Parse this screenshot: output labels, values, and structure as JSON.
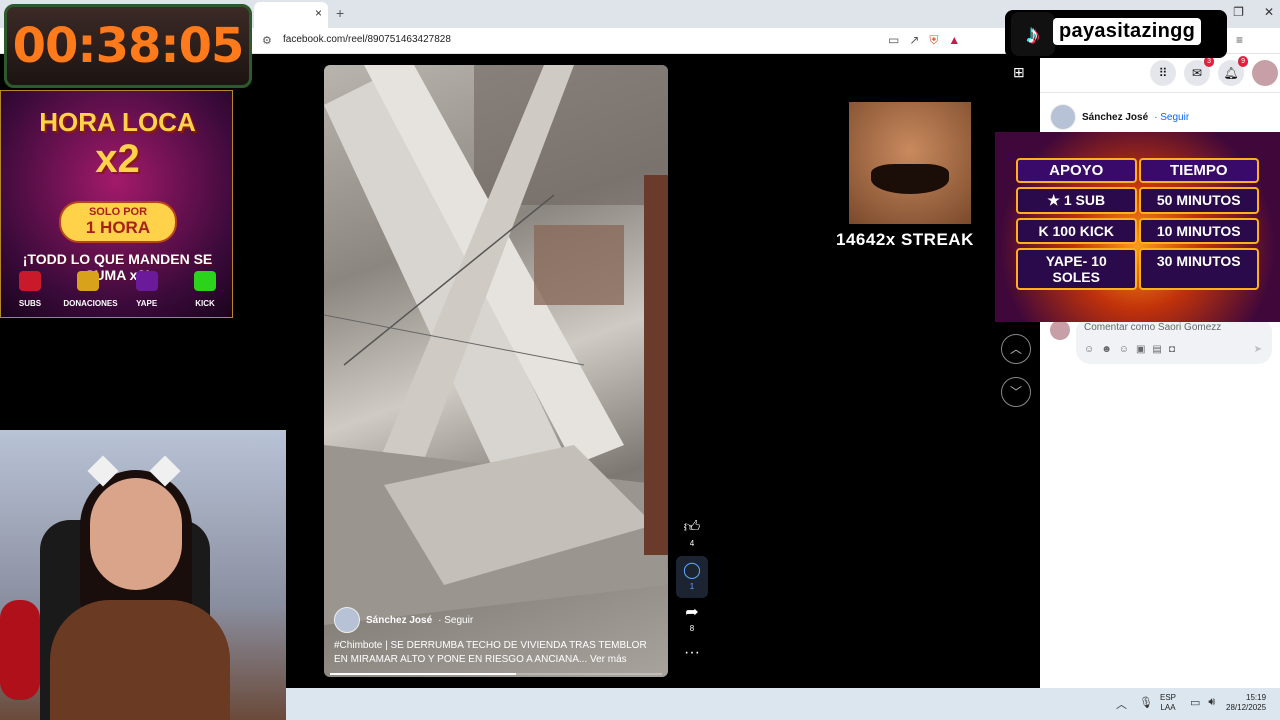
{
  "browser": {
    "tab_close": "×",
    "new_tab": "+",
    "url": "facebook.com/reel/890751463427828",
    "controls": [
      "—",
      "❐",
      "✕"
    ]
  },
  "reel": {
    "author": "Sánchez José",
    "follow": "· Seguir",
    "caption": "#Chimbote | SE DERRUMBA TECHO DE VIVIENDA TRAS TEMBLOR EN MIRAMAR ALTO Y PONE EN RIESGO A ANCIANA... Ver más",
    "progress": 0.56,
    "like_count": "4",
    "comment_count": "1",
    "share_count": "8",
    "more": "···"
  },
  "fb": {
    "messenger_badge": "3",
    "notifications_badge": "9",
    "post_author": "Sánchez José",
    "post_follow": "· Seguir",
    "comment_placeholder": "Comentar como Saori Gomezz"
  },
  "overlay": {
    "timer": "00:38:05",
    "streak": "14642x STREAK",
    "tiktok_name": "payasitazingg",
    "promo": {
      "title": "HORA LOCA",
      "x2": "x2",
      "pill_l1": "SOLO POR",
      "pill_l2": "1 HORA",
      "sub": "¡TODD LO QUE MANDEN SE SUMA x2!",
      "items": [
        "SUBS",
        "DONACIONES",
        "YAPE",
        "KICK"
      ]
    },
    "support": {
      "head": [
        "APOYO",
        "TIEMPO"
      ],
      "rows": [
        [
          "★ 1 SUB",
          "50 MINUTOS"
        ],
        [
          "K 100 KICK",
          "10 MINUTOS"
        ],
        [
          "YAPE- 10 SOLES",
          "30 MINUTOS"
        ]
      ]
    }
  },
  "taskbar": {
    "lang1": "ESP",
    "lang2": "LAA",
    "time": "15:19",
    "date": "28/12/2025"
  }
}
